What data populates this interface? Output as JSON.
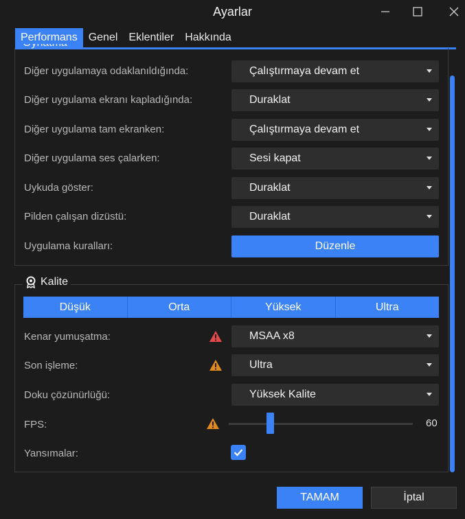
{
  "window": {
    "title": "Ayarlar"
  },
  "window_controls": [
    "minimize-icon",
    "maximize-icon",
    "close-icon"
  ],
  "tabs": [
    {
      "label": "Performans",
      "active": true
    },
    {
      "label": "Genel",
      "active": false
    },
    {
      "label": "Eklentiler",
      "active": false
    },
    {
      "label": "Hakkında",
      "active": false
    }
  ],
  "playback": {
    "title": "Oynatma",
    "rows": [
      {
        "label": "Diğer uygulamaya odaklanıldığında:",
        "value": "Çalıştırmaya devam et"
      },
      {
        "label": "Diğer uygulama ekranı kapladığında:",
        "value": "Duraklat"
      },
      {
        "label": "Diğer uygulama tam ekranken:",
        "value": "Çalıştırmaya devam et"
      },
      {
        "label": "Diğer uygulama ses çalarken:",
        "value": "Sesi kapat"
      },
      {
        "label": "Uykuda göster:",
        "value": "Duraklat"
      },
      {
        "label": "Pilden çalışan dizüstü:",
        "value": "Duraklat"
      }
    ],
    "app_rules": {
      "label": "Uygulama kuralları:",
      "button": "Düzenle"
    }
  },
  "quality": {
    "title": "Kalite",
    "icon": "award-icon",
    "presets": [
      "Düşük",
      "Orta",
      "Yüksek",
      "Ultra"
    ],
    "antialiasing": {
      "label": "Kenar yumuşatma:",
      "value": "MSAA x8",
      "warning_color": "#e5484d"
    },
    "postprocessing": {
      "label": "Son işleme:",
      "value": "Ultra",
      "warning_color": "#e08a1e"
    },
    "texture": {
      "label": "Doku çözünürlüğü:",
      "value": "Yüksek Kalite"
    },
    "fps": {
      "label": "FPS:",
      "value": "60",
      "slider_fraction": 0.22,
      "warning_color": "#e08a1e"
    },
    "reflections": {
      "label": "Yansımalar:",
      "checked": true
    }
  },
  "footer": {
    "ok": "TAMAM",
    "cancel": "İptal"
  },
  "colors": {
    "accent": "#3b82f6",
    "background": "#1c1c1c"
  }
}
